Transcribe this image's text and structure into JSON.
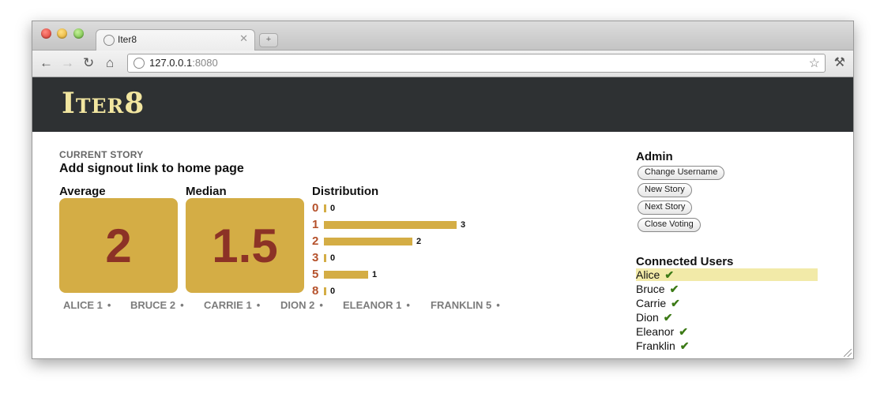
{
  "browser": {
    "tab_title": "Iter8",
    "url_host": "127.0.0.1",
    "url_port": ":8080"
  },
  "app": {
    "logo": "Iter8"
  },
  "current_story": {
    "label": "CURRENT STORY",
    "title": "Add signout link to home page"
  },
  "average": {
    "label": "Average",
    "value": "2"
  },
  "median": {
    "label": "Median",
    "value": "1.5"
  },
  "distribution": {
    "label": "Distribution",
    "rows": [
      {
        "category": "0",
        "count": 0
      },
      {
        "category": "1",
        "count": 3
      },
      {
        "category": "2",
        "count": 2
      },
      {
        "category": "3",
        "count": 0
      },
      {
        "category": "5",
        "count": 1
      },
      {
        "category": "8",
        "count": 0
      }
    ]
  },
  "votes": [
    {
      "name": "ALICE",
      "vote": "1"
    },
    {
      "name": "BRUCE",
      "vote": "2"
    },
    {
      "name": "CARRIE",
      "vote": "1"
    },
    {
      "name": "DION",
      "vote": "2"
    },
    {
      "name": "ELEANOR",
      "vote": "1"
    },
    {
      "name": "FRANKLIN",
      "vote": "5"
    }
  ],
  "admin": {
    "heading": "Admin",
    "buttons": [
      "Change Username",
      "New Story",
      "Next Story",
      "Close Voting"
    ]
  },
  "connected_users": {
    "heading": "Connected Users",
    "users": [
      "Alice",
      "Bruce",
      "Carrie",
      "Dion",
      "Eleanor",
      "Franklin"
    ],
    "check_glyph": "✔"
  },
  "colors": {
    "accent": "#d4ad45",
    "number": "#8c3226",
    "category": "#b5512b",
    "header": "#2e3133",
    "logo": "#f2e6a0",
    "highlight": "#f2eaa8",
    "check": "#3c7a16"
  }
}
